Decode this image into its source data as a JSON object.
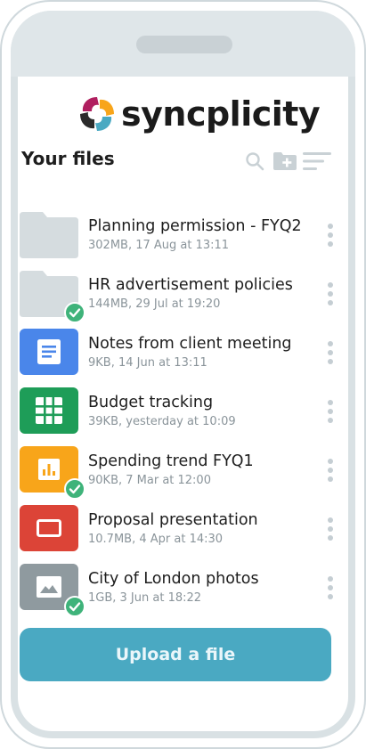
{
  "app": {
    "brand_name": "syncplicity"
  },
  "header": {
    "title": "Your files"
  },
  "toolbar": {
    "search_icon": "search-icon",
    "new_folder_icon": "new-folder-icon",
    "sort_icon": "sort-icon"
  },
  "files": [
    {
      "name": "Planning permission - FYQ2",
      "meta": "302MB, 17 Aug at 13:11",
      "type": "folder",
      "synced": false
    },
    {
      "name": "HR advertisement policies",
      "meta": "144MB, 29 Jul at 19:20",
      "type": "folder",
      "synced": true
    },
    {
      "name": "Notes from client meeting",
      "meta": "9KB, 14 Jun at 13:11",
      "type": "document",
      "synced": false
    },
    {
      "name": "Budget tracking",
      "meta": "39KB, yesterday at 10:09",
      "type": "spreadsheet",
      "synced": false
    },
    {
      "name": "Spending trend FYQ1",
      "meta": "90KB, 7 Mar at 12:00",
      "type": "chart",
      "synced": true
    },
    {
      "name": "Proposal presentation",
      "meta": "10.7MB, 4 Apr at 14:30",
      "type": "presentation",
      "synced": false
    },
    {
      "name": "City of London photos",
      "meta": "1GB, 3 Jun at 18:22",
      "type": "image",
      "synced": true
    }
  ],
  "actions": {
    "upload_label": "Upload a file"
  },
  "colors": {
    "accent": "#4aa9c2",
    "document": "#4a86ea",
    "spreadsheet": "#1e9d58",
    "chart": "#f8a51a",
    "presentation": "#dc4437",
    "image": "#8f9a9f",
    "folder": "#d5dcdf",
    "synced": "#3fb37a"
  }
}
